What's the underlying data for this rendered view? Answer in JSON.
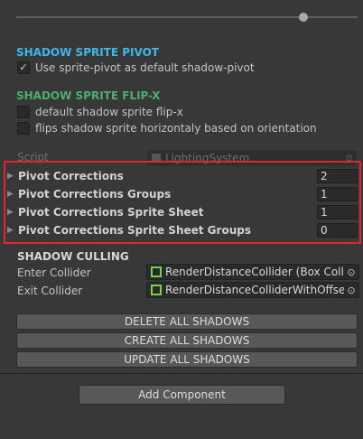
{
  "slider": {
    "value": 0.86
  },
  "pivot_section": {
    "title": "SHADOW SPRITE PIVOT",
    "toggle": {
      "label": "Use sprite-pivot as default shadow-pivot",
      "checked": true
    }
  },
  "flip_section": {
    "title": "SHADOW SPRITE FLIP-X",
    "toggles": [
      {
        "label": "default shadow sprite flip-x",
        "checked": false
      },
      {
        "label": "flips shadow sprite horizontaly based on orientation",
        "checked": false
      }
    ]
  },
  "script_field": {
    "label": "Script",
    "value": "LightingSystem"
  },
  "corrections": [
    {
      "label": "Pivot Corrections",
      "value": "2"
    },
    {
      "label": "Pivot Corrections Groups",
      "value": "1"
    },
    {
      "label": "Pivot Corrections Sprite Sheet",
      "value": "1"
    },
    {
      "label": "Pivot Corrections Sprite Sheet Groups",
      "value": "0"
    }
  ],
  "culling": {
    "title": "SHADOW CULLING",
    "fields": [
      {
        "label": "Enter Collider",
        "value": "RenderDistanceCollider (Box Collide"
      },
      {
        "label": "Exit Collider",
        "value": "RenderDistanceColliderWithOffset (E"
      }
    ]
  },
  "buttons": {
    "delete": "DELETE ALL SHADOWS",
    "create": "CREATE ALL SHADOWS",
    "update": "UPDATE ALL SHADOWS"
  },
  "add_component": "Add Component",
  "colors": {
    "accent_blue": "#3fb7ea",
    "accent_green": "#4caf70",
    "highlight_red": "#e2242b",
    "collider_green": "#7bd14b"
  }
}
